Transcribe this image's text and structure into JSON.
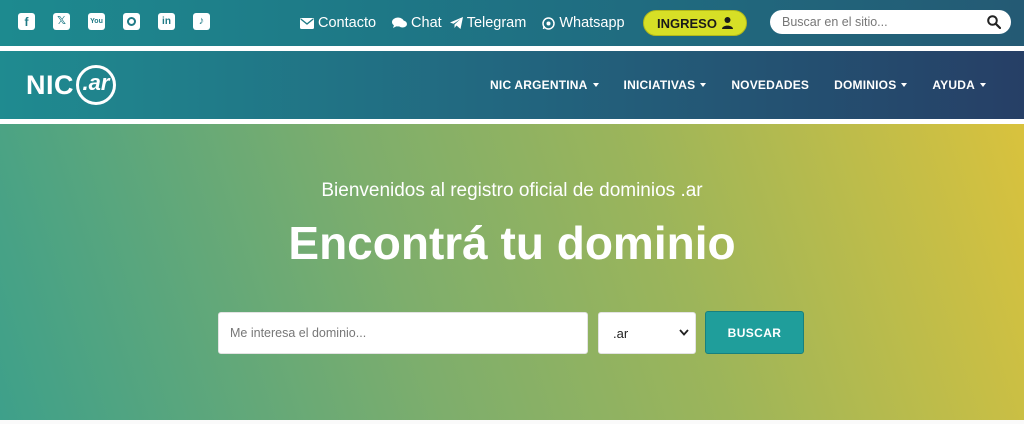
{
  "social": [
    {
      "name": "facebook-icon",
      "glyph": "f"
    },
    {
      "name": "x-icon",
      "glyph": "𝕏"
    },
    {
      "name": "youtube-icon",
      "glyph": "You"
    },
    {
      "name": "instagram-icon",
      "glyph": ""
    },
    {
      "name": "linkedin-icon",
      "glyph": "in"
    },
    {
      "name": "tiktok-icon",
      "glyph": "♪"
    }
  ],
  "toplinks": {
    "contacto": "Contacto",
    "chat": "Chat",
    "telegram": "Telegram",
    "whatsapp": "Whatsapp"
  },
  "ingreso": {
    "label": "INGRESO"
  },
  "site_search": {
    "placeholder": "Buscar en el sitio..."
  },
  "logo": {
    "nic": "NIC",
    "ar": ".ar"
  },
  "nav": {
    "items": [
      {
        "label": "NIC ARGENTINA",
        "dropdown": true
      },
      {
        "label": "INICIATIVAS",
        "dropdown": true
      },
      {
        "label": "NOVEDADES",
        "dropdown": false
      },
      {
        "label": "DOMINIOS",
        "dropdown": true
      },
      {
        "label": "AYUDA",
        "dropdown": true
      }
    ]
  },
  "hero": {
    "subtitle": "Bienvenidos al registro oficial de dominios .ar",
    "headline": "Encontrá tu dominio",
    "domain_placeholder": "Me interesa el dominio...",
    "tld_selected": ".ar",
    "search_button": "BUSCAR"
  },
  "colors": {
    "accent_yellow": "#d7df26",
    "button_teal": "#1f9e9b",
    "topbar_teal": "#1d8a8f",
    "nav_navy": "#263f66"
  }
}
